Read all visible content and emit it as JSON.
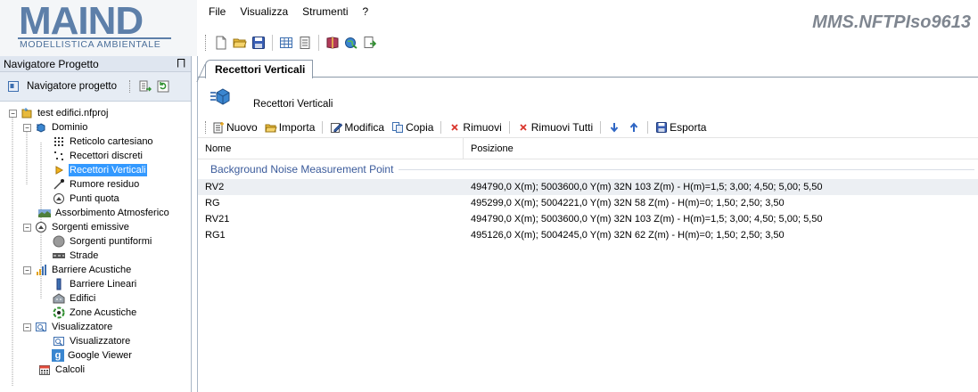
{
  "logo": {
    "main": "MAIND",
    "sub": "MODELLISTICA AMBIENTALE"
  },
  "menu": [
    "File",
    "Visualizza",
    "Strumenti",
    "?"
  ],
  "app_title": "MMS.NFTPIso9613",
  "navigator": {
    "title": "Navigatore Progetto",
    "pin": "⨅",
    "tab_label": "Navigatore progetto"
  },
  "tree": [
    {
      "label": "test edifici.nfproj",
      "icon": "project-folder-icon",
      "expander": "−"
    },
    {
      "label": "Dominio",
      "icon": "domain-icon",
      "expander": "−"
    },
    {
      "label": "Reticolo cartesiano",
      "icon": "grid-icon"
    },
    {
      "label": "Recettori discreti",
      "icon": "discrete-receivers-icon"
    },
    {
      "label": "Recettori Verticali",
      "icon": "vertical-receivers-icon"
    },
    {
      "label": "Rumore residuo",
      "icon": "residual-noise-icon"
    },
    {
      "label": "Punti quota",
      "icon": "elevation-points-icon"
    },
    {
      "label": "Assorbimento Atmosferico",
      "icon": "atmosphere-icon"
    },
    {
      "label": "Sorgenti emissive",
      "icon": "sources-icon",
      "expander": "−"
    },
    {
      "label": "Sorgenti puntiformi",
      "icon": "point-source-icon"
    },
    {
      "label": "Strade",
      "icon": "road-icon"
    },
    {
      "label": "Barriere Acustiche",
      "icon": "barriers-icon",
      "expander": "−"
    },
    {
      "label": "Barriere Lineari",
      "icon": "linear-barrier-icon"
    },
    {
      "label": "Edifici",
      "icon": "buildings-icon"
    },
    {
      "label": "Zone Acustiche",
      "icon": "acoustic-zones-icon"
    },
    {
      "label": "Visualizzatore",
      "icon": "viewer-icon",
      "expander": "−"
    },
    {
      "label": "Visualizzatore",
      "icon": "viewer-window-icon"
    },
    {
      "label": "Google Viewer",
      "icon": "google-icon",
      "glyph": "g"
    },
    {
      "label": "Calcoli",
      "icon": "calculator-icon"
    }
  ],
  "doc_tab": "Recettori Verticali",
  "section_title": "Recettori Verticali",
  "actions": {
    "new": "Nuovo",
    "import": "Importa",
    "edit": "Modifica",
    "copy": "Copia",
    "remove": "Rimuovi",
    "remove_all": "Rimuovi Tutti",
    "export": "Esporta"
  },
  "grid": {
    "columns": [
      "Nome",
      "Posizione"
    ],
    "group": "Background Noise Measurement Point",
    "rows": [
      {
        "name": "RV2",
        "position": "494790,0 X(m); 5003600,0 Y(m) 32N  103 Z(m) - H(m)=1,5; 3,00; 4,50; 5,00; 5,50"
      },
      {
        "name": "RG",
        "position": "495299,0 X(m); 5004221,0 Y(m) 32N  58 Z(m) - H(m)=0; 1,50; 2,50; 3,50"
      },
      {
        "name": "RV21",
        "position": "494790,0 X(m); 5003600,0 Y(m) 32N  103 Z(m) - H(m)=1,5; 3,00; 4,50; 5,00; 5,50"
      },
      {
        "name": "RG1",
        "position": "495126,0 X(m); 5004245,0 Y(m) 32N  62 Z(m) - H(m)=0; 1,50; 2,50; 3,50"
      }
    ]
  },
  "colors": {
    "logo_blue": "#5d7fa9",
    "selection": "#3399ff",
    "group_text": "#3b5b9b",
    "alt_row": "#eceff3"
  }
}
